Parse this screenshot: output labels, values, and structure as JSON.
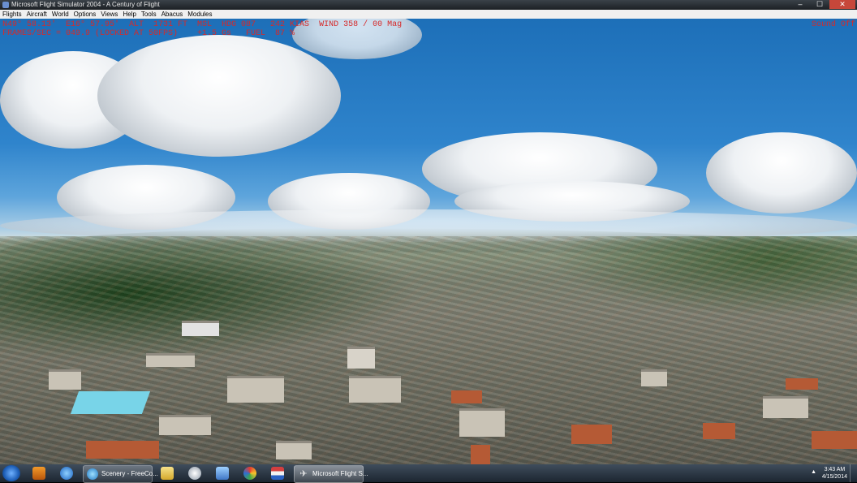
{
  "window": {
    "title": "Microsoft Flight Simulator 2004 - A Century of Flight",
    "minimize": "–",
    "maximize": "☐",
    "close": "✕"
  },
  "menu": [
    "Flights",
    "Aircraft",
    "World",
    "Options",
    "Views",
    "Help",
    "Tools",
    "Abacus",
    "Modules"
  ],
  "hud": {
    "line1": "N49° 58.13'  E16° 57.95'  ALT  1731 FT  MSL  HDG 087   242 KIAS  WIND 358 / 00 Mag",
    "line2": "FRAMES/SEC = 049.9 (LOCKED AT 50FPS)    +1.5 Gs   FUEL  87 %",
    "sound": "Sound Off",
    "color": "#d62a2a"
  },
  "taskbar": {
    "pinned_icons": [
      "windows-media-player-icon",
      "internet-explorer-icon"
    ],
    "windows": [
      {
        "label": "Scenery - FreeCo...",
        "icon": "globe-icon"
      },
      {
        "label": "Microsoft Flight S...",
        "icon": "airplane-icon"
      }
    ],
    "extra_icons": [
      "folder-icon",
      "tool-icon",
      "network-icon",
      "colorful-app-icon",
      "flag-icon"
    ],
    "clock": {
      "time": "3:43 AM",
      "date": "4/15/2014"
    },
    "tray_arrow": "▲"
  }
}
